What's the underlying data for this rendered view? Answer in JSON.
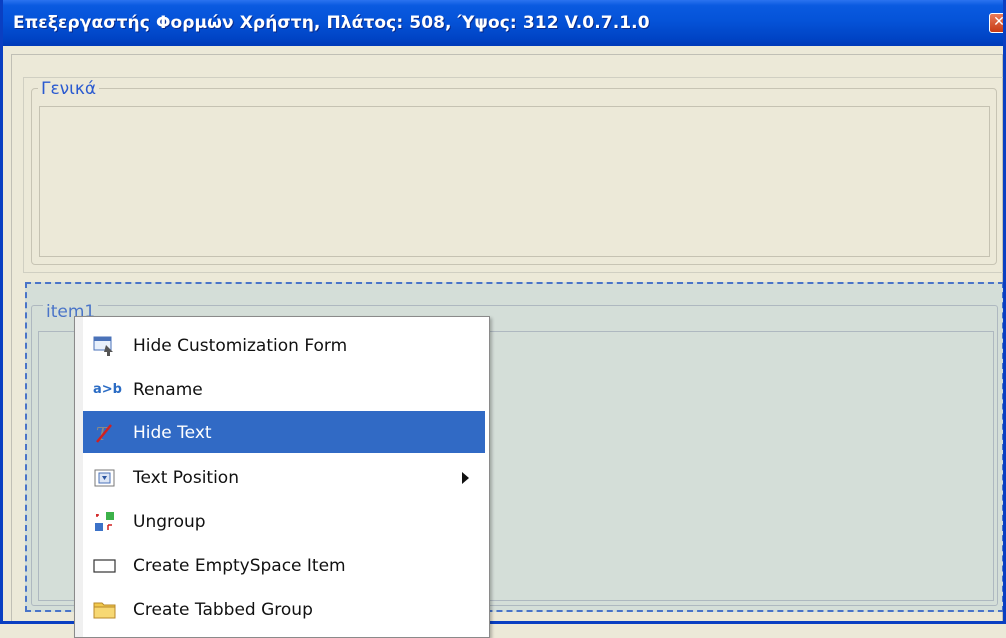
{
  "window": {
    "title": "Επεξεργαστής Φορμών Χρήστη, Πλάτος: 508, Ύψος: 312 V.0.7.1.0",
    "close_glyph": "✕"
  },
  "groups": {
    "general": {
      "label": "Γενικά"
    },
    "item1": {
      "label": "item1"
    }
  },
  "context_menu": {
    "items": [
      {
        "label": "Hide Customization Form",
        "icon": "hide-customization-icon"
      },
      {
        "label": "Rename",
        "icon": "rename-icon",
        "icon_text": "a>b"
      },
      {
        "label": "Hide Text",
        "icon": "hide-text-icon",
        "highlighted": true
      },
      {
        "label": "Text Position",
        "icon": "text-position-icon",
        "submenu": true
      },
      {
        "label": "Ungroup",
        "icon": "ungroup-icon"
      },
      {
        "label": "Create EmptySpace Item",
        "icon": "empty-space-icon"
      },
      {
        "label": "Create Tabbed Group",
        "icon": "folder-icon"
      }
    ]
  },
  "colors": {
    "titlebar": "#0553d8",
    "highlight": "#316ac5",
    "legend": "#2a5ad0",
    "item_group_bg": "#d4ded8"
  }
}
